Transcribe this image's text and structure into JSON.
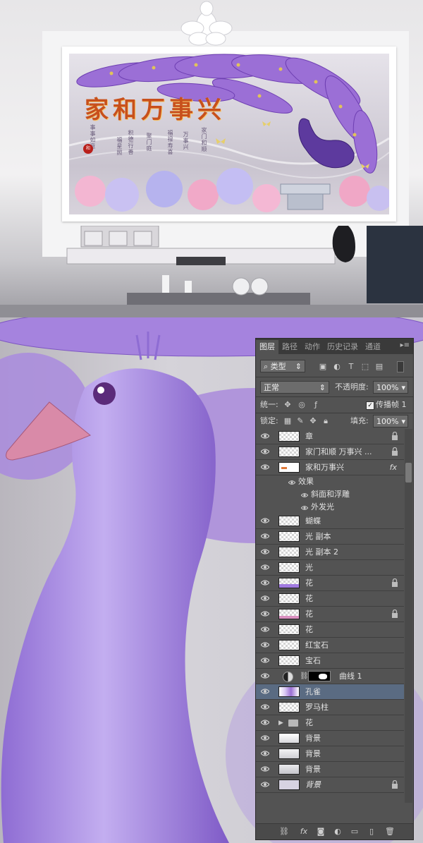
{
  "mural": {
    "title": "家和万事兴",
    "blessings": [
      "事事如意",
      "福星照",
      "积德行善",
      "聚门庭",
      "福禄寿喜",
      "万事兴",
      "家门和顺"
    ],
    "stamp": "和"
  },
  "panel": {
    "tabs": [
      "图层",
      "路径",
      "动作",
      "历史记录",
      "通道"
    ],
    "filter_kind": "类型",
    "blend_mode": "正常",
    "opacity_label": "不透明度:",
    "opacity_value": "100%",
    "unify_label": "统一:",
    "propagate_label": "传播帧 1",
    "lock_label": "锁定:",
    "fill_label": "填充:",
    "fill_value": "100%",
    "layers": [
      {
        "name": "章",
        "locked": true,
        "thumb": "blank"
      },
      {
        "name": "家门和顺 万事兴 ...",
        "locked": true,
        "thumb": "blank"
      },
      {
        "name": "家和万事兴",
        "locked": false,
        "thumb": "text",
        "fx": "fx"
      },
      {
        "name": "蝴蝶",
        "locked": false,
        "thumb": "blank"
      },
      {
        "name": "光 副本",
        "locked": false,
        "thumb": "blank"
      },
      {
        "name": "光 副本 2",
        "locked": false,
        "thumb": "blank"
      },
      {
        "name": "光",
        "locked": false,
        "thumb": "blank"
      },
      {
        "name": "花",
        "locked": true,
        "thumb": "flower"
      },
      {
        "name": "花",
        "locked": false,
        "thumb": "blank"
      },
      {
        "name": "花",
        "locked": true,
        "thumb": "flower2"
      },
      {
        "name": "花",
        "locked": false,
        "thumb": "blank"
      },
      {
        "name": "红宝石",
        "locked": false,
        "thumb": "blank"
      },
      {
        "name": "宝石",
        "locked": false,
        "thumb": "blank"
      },
      {
        "name": "曲线 1",
        "locked": false,
        "thumb": "curves"
      },
      {
        "name": "孔雀",
        "locked": false,
        "thumb": "peacock",
        "selected": true
      },
      {
        "name": "罗马柱",
        "locked": false,
        "thumb": "blank"
      },
      {
        "name": "花",
        "locked": false,
        "thumb": "folder"
      },
      {
        "name": "背景",
        "locked": false,
        "thumb": "bg1"
      },
      {
        "name": "背景",
        "locked": false,
        "thumb": "bg2"
      },
      {
        "name": "背景",
        "locked": false,
        "thumb": "bg3"
      },
      {
        "name": "背景",
        "locked": true,
        "thumb": "bgbase",
        "italic": true
      }
    ],
    "effects": {
      "header": "效果",
      "items": [
        "斜面和浮雕",
        "外发光"
      ]
    },
    "bottom_icons": [
      "link-icon",
      "fx-icon",
      "mask-icon",
      "adjustment-icon",
      "folder-icon",
      "new-layer-icon",
      "trash-icon"
    ],
    "fx_symbol": "fx"
  },
  "colors": {
    "panel_bg": "#535353",
    "selected_row": "#5a6b82",
    "mural_title": "#c8501c",
    "peacock": "#a07ad6"
  }
}
